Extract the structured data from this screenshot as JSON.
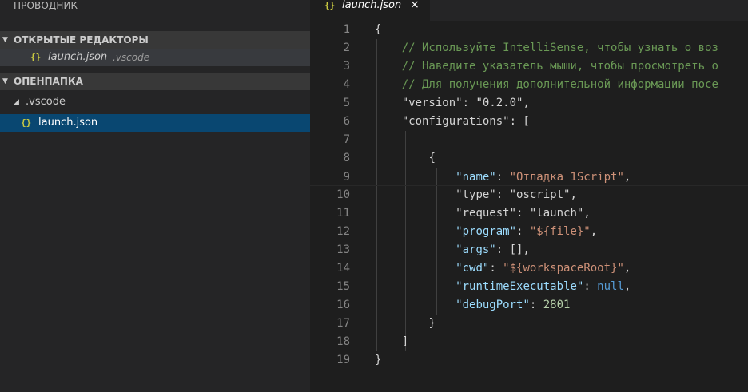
{
  "sidebar": {
    "title": "ПРОВОДНИК",
    "open_editors": {
      "header": "ОТКРЫТЫЕ РЕДАКТОРЫ",
      "items": [
        {
          "name": "launch.json",
          "path": ".vscode"
        }
      ]
    },
    "folder": {
      "header": "ОПЕНПАПКА",
      "tree": [
        {
          "name": ".vscode"
        },
        {
          "name": "launch.json"
        }
      ]
    }
  },
  "editor": {
    "tab": {
      "label": "launch.json",
      "close": "×"
    },
    "file_icon": "{}",
    "lines": [
      [
        {
          "t": "{",
          "c": "c-punc"
        }
      ],
      [
        {
          "t": "    "
        },
        {
          "t": "// Используйте IntelliSense, чтобы узнать о воз",
          "c": "c-comment"
        }
      ],
      [
        {
          "t": "    "
        },
        {
          "t": "// Наведите указатель мыши, чтобы просмотреть о",
          "c": "c-comment"
        }
      ],
      [
        {
          "t": "    "
        },
        {
          "t": "// Для получения дополнительной информации посе",
          "c": "c-comment"
        }
      ],
      [
        {
          "t": "    "
        },
        {
          "t": "\"version\"",
          "c": "c-punc"
        },
        {
          "t": ": ",
          "c": "c-punc"
        },
        {
          "t": "\"0.2.0\"",
          "c": "c-punc"
        },
        {
          "t": ",",
          "c": "c-punc"
        }
      ],
      [
        {
          "t": "    "
        },
        {
          "t": "\"configurations\"",
          "c": "c-punc"
        },
        {
          "t": ": [",
          "c": "c-punc"
        }
      ],
      [
        {
          "t": ""
        }
      ],
      [
        {
          "t": "        "
        },
        {
          "t": "{",
          "c": "c-punc"
        }
      ],
      [
        {
          "t": "            "
        },
        {
          "t": "\"name\"",
          "c": "c-key"
        },
        {
          "t": ": ",
          "c": "c-punc"
        },
        {
          "t": "\"Отладка 1Script\"",
          "c": "c-str"
        },
        {
          "t": ",",
          "c": "c-punc"
        }
      ],
      [
        {
          "t": "            "
        },
        {
          "t": "\"type\"",
          "c": "c-punc"
        },
        {
          "t": ": ",
          "c": "c-punc"
        },
        {
          "t": "\"oscript\"",
          "c": "c-punc"
        },
        {
          "t": ",",
          "c": "c-punc"
        }
      ],
      [
        {
          "t": "            "
        },
        {
          "t": "\"request\"",
          "c": "c-punc"
        },
        {
          "t": ": ",
          "c": "c-punc"
        },
        {
          "t": "\"launch\"",
          "c": "c-punc"
        },
        {
          "t": ",",
          "c": "c-punc"
        }
      ],
      [
        {
          "t": "            "
        },
        {
          "t": "\"program\"",
          "c": "c-key"
        },
        {
          "t": ": ",
          "c": "c-punc"
        },
        {
          "t": "\"${file}\"",
          "c": "c-str"
        },
        {
          "t": ",",
          "c": "c-punc"
        }
      ],
      [
        {
          "t": "            "
        },
        {
          "t": "\"args\"",
          "c": "c-key"
        },
        {
          "t": ": [],",
          "c": "c-punc"
        }
      ],
      [
        {
          "t": "            "
        },
        {
          "t": "\"cwd\"",
          "c": "c-key"
        },
        {
          "t": ": ",
          "c": "c-punc"
        },
        {
          "t": "\"${workspaceRoot}\"",
          "c": "c-str"
        },
        {
          "t": ",",
          "c": "c-punc"
        }
      ],
      [
        {
          "t": "            "
        },
        {
          "t": "\"runtimeExecutable\"",
          "c": "c-key"
        },
        {
          "t": ": ",
          "c": "c-punc"
        },
        {
          "t": "null",
          "c": "c-kw"
        },
        {
          "t": ",",
          "c": "c-punc"
        }
      ],
      [
        {
          "t": "            "
        },
        {
          "t": "\"debugPort\"",
          "c": "c-key"
        },
        {
          "t": ": ",
          "c": "c-punc"
        },
        {
          "t": "2801",
          "c": "c-num"
        }
      ],
      [
        {
          "t": "        "
        },
        {
          "t": "}",
          "c": "c-punc"
        }
      ],
      [
        {
          "t": "    "
        },
        {
          "t": "]",
          "c": "c-punc"
        }
      ],
      [
        {
          "t": "}",
          "c": "c-punc"
        }
      ]
    ],
    "line_numbers": [
      "1",
      "2",
      "3",
      "4",
      "5",
      "6",
      "7",
      "8",
      "9",
      "10",
      "11",
      "12",
      "13",
      "14",
      "15",
      "16",
      "17",
      "18",
      "19"
    ],
    "current_line": 9
  },
  "colors": {
    "selection": "#094771",
    "json_icon": "#cbcb41"
  },
  "icons": {
    "twisty_open": "chevron-down-icon",
    "json_file": "json-file-icon",
    "close": "close-icon"
  }
}
